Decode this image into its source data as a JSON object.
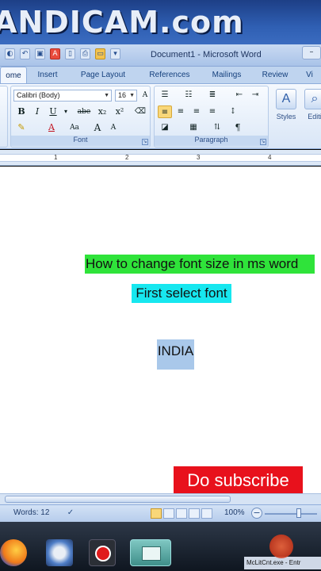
{
  "watermark": {
    "text": "ANDICAM.com"
  },
  "window": {
    "title": "Document1 - Microsoft Word"
  },
  "tabs": [
    {
      "label": "ome",
      "active": true
    },
    {
      "label": "Insert"
    },
    {
      "label": "Page Layout"
    },
    {
      "label": "References"
    },
    {
      "label": "Mailings"
    },
    {
      "label": "Review"
    },
    {
      "label": "Vi"
    }
  ],
  "ribbon": {
    "font": {
      "name": "Calibri (Body)",
      "size": "16",
      "group_label": "Font",
      "bold": "B",
      "italic": "I",
      "underline": "U",
      "strike": "abe",
      "subscript": "x₂",
      "superscript": "x²",
      "change_case": "Aa",
      "grow": "A",
      "shrink": "A"
    },
    "paragraph": {
      "group_label": "Paragraph"
    },
    "styles": {
      "label": "Styles"
    },
    "editing": {
      "label": "Editi"
    }
  },
  "ruler": {
    "numbers": [
      "1",
      "2",
      "3",
      "4"
    ]
  },
  "document": {
    "line1": "How to change font size in ms word",
    "line2": "First select font",
    "line3": "INDIA"
  },
  "overlay": {
    "subscribe": "Do subscribe"
  },
  "status_bar": {
    "words": "Words: 12",
    "zoom": "100%"
  },
  "taskbar": {
    "tray_label": "McLitCnt.exe - Entr"
  },
  "colors": {
    "highlight_green": "#2fe33a",
    "highlight_cyan": "#17e7ef",
    "selection": "#a9c8ea",
    "subscribe_red": "#e8111c"
  }
}
